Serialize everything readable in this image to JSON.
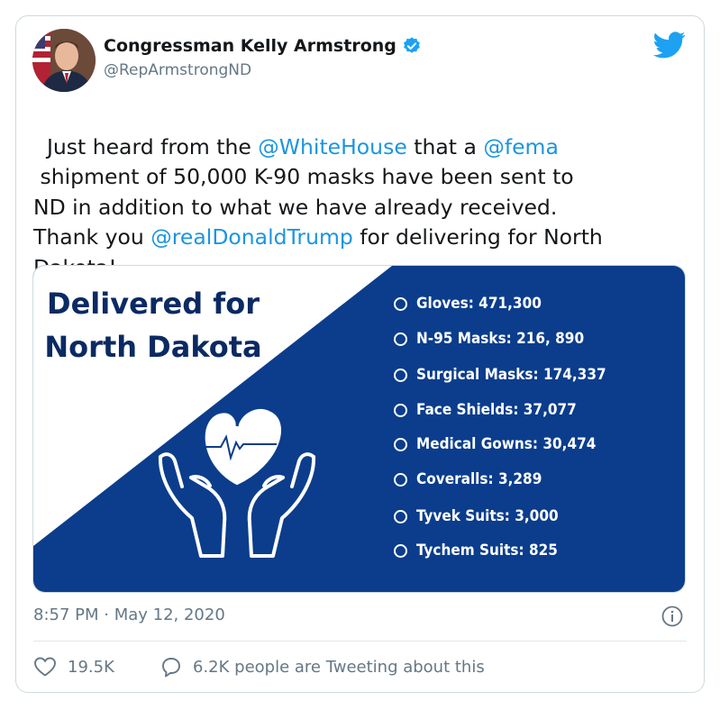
{
  "author": {
    "display_name": "Congressman Kelly Armstrong",
    "handle": "@RepArmstrongND",
    "verified": true
  },
  "tweet": {
    "text_parts": [
      {
        "text": "Just heard from the ",
        "mention": false
      },
      {
        "text": "@WhiteHouse",
        "mention": true
      },
      {
        "text": " that a ",
        "mention": false
      },
      {
        "text": "@fema",
        "mention": true
      },
      {
        "text": "\n shipment of 50,000 K-90 masks have been sent to\nND in addition to what we have already received.\nThank you ",
        "mention": false
      },
      {
        "text": "@realDonaldTrump",
        "mention": true
      },
      {
        "text": " for delivering for North\nDakota!",
        "mention": false
      }
    ],
    "timestamp": "8:57 PM · May 12, 2020"
  },
  "media": {
    "headline_line1": "Delivered for",
    "headline_line2": "North Dakota",
    "items": [
      "Gloves: 471,300",
      "N-95 Masks: 216, 890",
      "Surgical Masks: 174,337",
      "Face Shields: 37,077",
      "Medical Gowns: 30,474",
      "Coveralls: 3,289",
      "Tyvek Suits: 3,000",
      "Tychem Suits: 825"
    ]
  },
  "actions": {
    "likes": "19.5K",
    "conversation": "6.2K people are Tweeting about this"
  },
  "colors": {
    "brand_blue": "#1da1f2",
    "mention_blue": "#1b95e0",
    "navy": "#0b3d8c",
    "headline_navy": "#0b2a63",
    "muted_gray": "#657786"
  },
  "icons": [
    "verified-badge-icon",
    "twitter-bird-icon",
    "info-icon",
    "heart-icon",
    "reply-bubble-icon",
    "ecg-heart-icon",
    "hands-icon"
  ]
}
